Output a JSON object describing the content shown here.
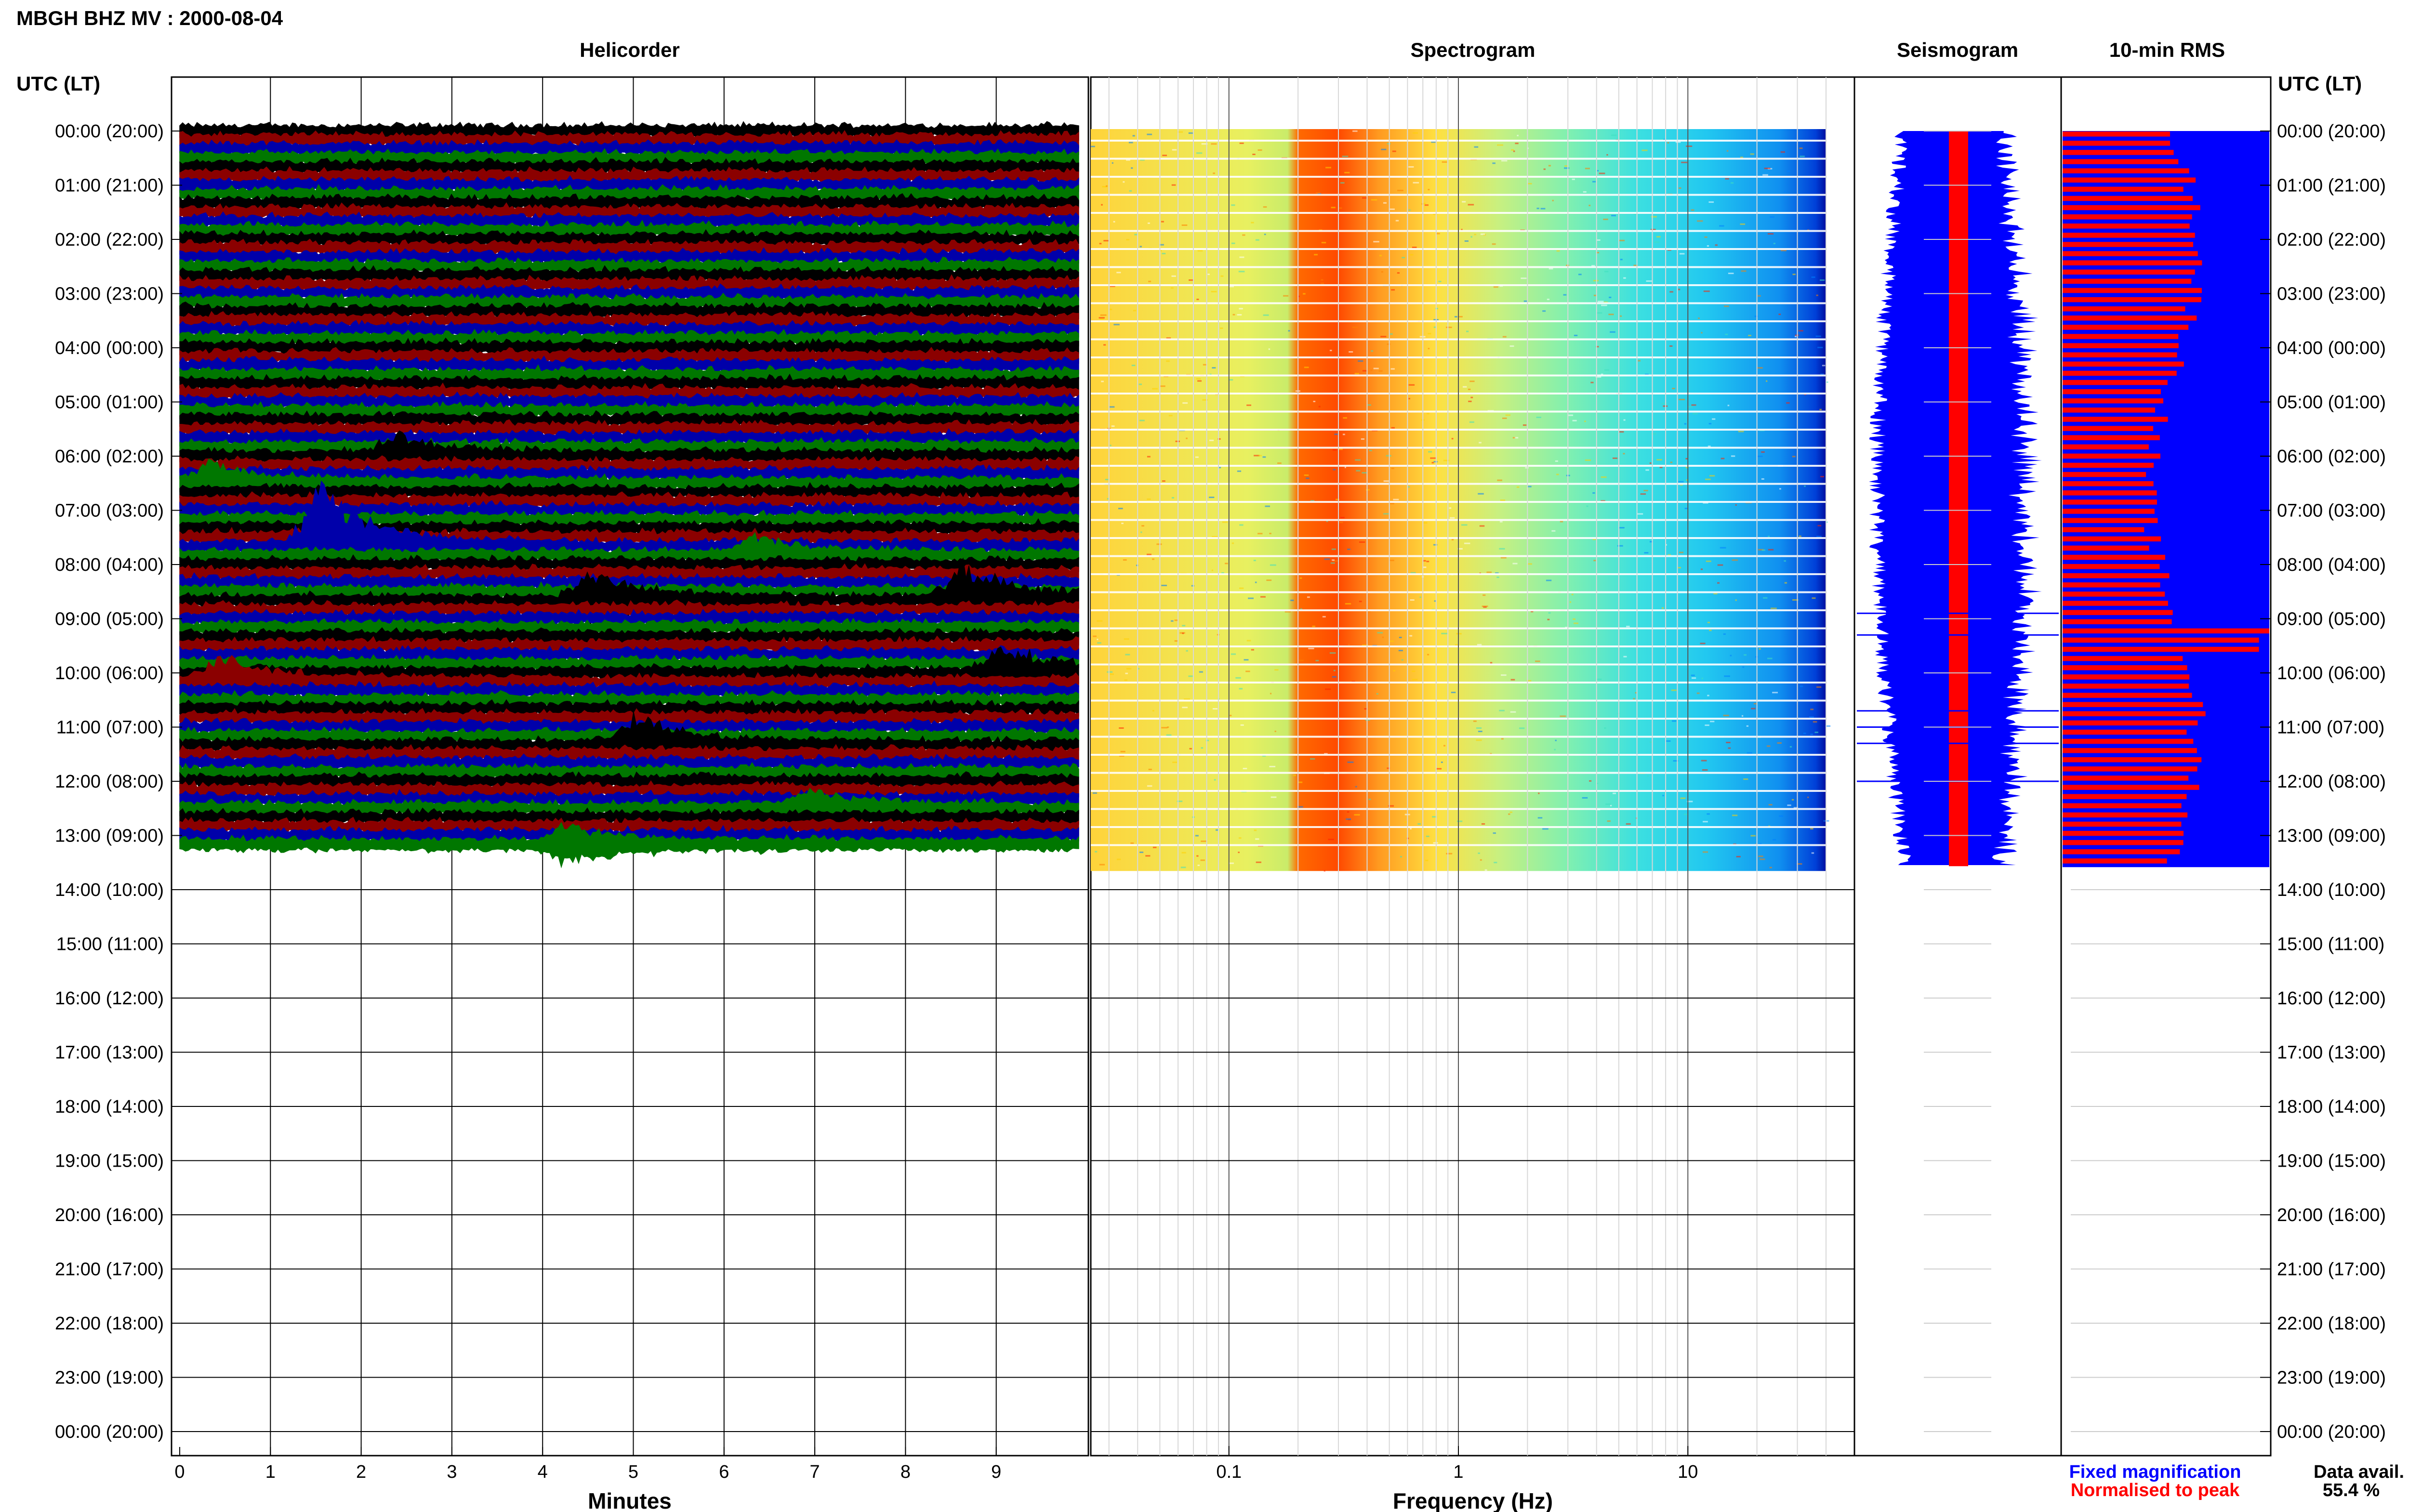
{
  "title": "MBGH BHZ MV : 2000-08-04",
  "panels": {
    "helicorder": "Helicorder",
    "spectrogram": "Spectrogram",
    "seismogram": "Seismogram",
    "rms": "10-min RMS"
  },
  "time_axis_label": "UTC (LT)",
  "time_labels": [
    "00:00 (20:00)",
    "01:00 (21:00)",
    "02:00 (22:00)",
    "03:00 (23:00)",
    "04:00 (00:00)",
    "05:00 (01:00)",
    "06:00 (02:00)",
    "07:00 (03:00)",
    "08:00 (04:00)",
    "09:00 (05:00)",
    "10:00 (06:00)",
    "11:00 (07:00)",
    "12:00 (08:00)",
    "13:00 (09:00)",
    "14:00 (10:00)",
    "15:00 (11:00)",
    "16:00 (12:00)",
    "17:00 (13:00)",
    "18:00 (14:00)",
    "19:00 (15:00)",
    "20:00 (16:00)",
    "21:00 (17:00)",
    "22:00 (18:00)",
    "23:00 (19:00)",
    "00:00 (20:00)"
  ],
  "legend": {
    "fixed": "Fixed magnification",
    "normalised": "Normalised to peak",
    "fixed_color": "#0000ff",
    "normalised_color": "#ff0000"
  },
  "data_avail_label": "Data avail.",
  "data_avail_value": "55.4 %",
  "chart_data": [
    {
      "type": "line",
      "panel": "Helicorder",
      "xlabel": "Minutes",
      "x_ticks": [
        "0",
        "1",
        "2",
        "3",
        "4",
        "5",
        "6",
        "7",
        "8",
        "9"
      ],
      "xlim": [
        0,
        10
      ],
      "ylabel": "UTC (LT)",
      "trace_colors": [
        "#000000",
        "#8b0000",
        "#0000aa",
        "#007700"
      ],
      "data_end_hours": 13.3,
      "events": [
        {
          "hour": 7.6,
          "minute": 1.5,
          "amplitude": 4.0,
          "color": "#007700"
        },
        {
          "hour": 6.0,
          "minute": 2.3,
          "amplitude": 1.2,
          "color": "#007700"
        },
        {
          "hour": 6.5,
          "minute": 0.3,
          "amplitude": 1.0,
          "color": "#8b0000"
        },
        {
          "hour": 7.8,
          "minute": 6.3,
          "amplitude": 1.1,
          "color": "#000000"
        },
        {
          "hour": 8.6,
          "minute": 4.5,
          "amplitude": 1.6,
          "color": "#007700"
        },
        {
          "hour": 8.6,
          "minute": 8.6,
          "amplitude": 2.2,
          "color": "#007700"
        },
        {
          "hour": 10.0,
          "minute": 9.0,
          "amplitude": 1.6,
          "color": "#007700"
        },
        {
          "hour": 10.2,
          "minute": 0.4,
          "amplitude": 1.5,
          "color": "#8b0000"
        },
        {
          "hour": 11.4,
          "minute": 5.0,
          "amplitude": 1.7,
          "color": "#007700"
        },
        {
          "hour": 12.5,
          "minute": 6.9,
          "amplitude": 1.0,
          "color": "#8b0000"
        },
        {
          "hour": 13.1,
          "minute": 4.2,
          "amplitude": 1.0,
          "color": "#007700"
        }
      ]
    },
    {
      "type": "heatmap",
      "panel": "Spectrogram",
      "xlabel": "Frequency (Hz)",
      "xscale": "log",
      "xlim": [
        0.025,
        40
      ],
      "x_ticks": [
        "0.1",
        "1",
        "10"
      ],
      "data_end_hours": 13.3,
      "colormap": "jet",
      "peak_band_hz": [
        0.2,
        0.7
      ]
    },
    {
      "type": "line",
      "panel": "Seismogram",
      "data_end_hours": 13.3,
      "series": [
        {
          "name": "Fixed magnification",
          "color": "#0000ff"
        },
        {
          "name": "Normalised to peak",
          "color": "#ff0000"
        }
      ]
    },
    {
      "type": "bar",
      "panel": "10-min RMS",
      "bar_count": 80,
      "series": [
        {
          "name": "Fixed magnification",
          "color": "#0000ff",
          "value_relative": 1.0
        },
        {
          "name": "Normalised to peak",
          "color": "#ff0000",
          "values_relative_min": 0.35,
          "values_relative_max": 1.0,
          "spikes": [
            {
              "hour": 8.95,
              "value": 1.0
            },
            {
              "hour": 9.25,
              "value": 0.95
            },
            {
              "hour": 10.9,
              "value": 0.6
            },
            {
              "hour": 11.2,
              "value": 0.65
            },
            {
              "hour": 12.0,
              "value": 0.6
            }
          ]
        }
      ]
    }
  ]
}
